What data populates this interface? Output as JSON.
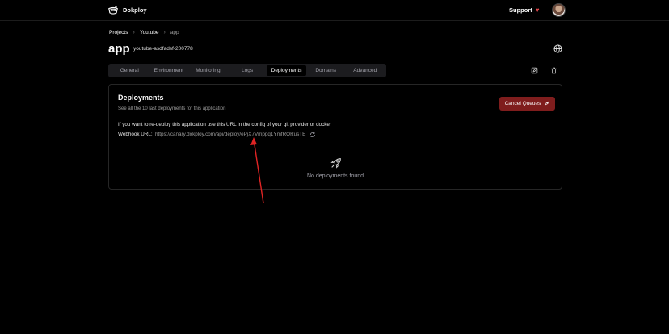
{
  "header": {
    "brand": "Dokploy",
    "support_label": "Support",
    "heart_icon": "♥"
  },
  "breadcrumb": {
    "items": [
      "Projects",
      "Youtube"
    ],
    "current": "app",
    "separator": "›"
  },
  "app": {
    "title": "app",
    "id": "youtube-asdfadsf-200778"
  },
  "tabs": [
    {
      "label": "General"
    },
    {
      "label": "Environment"
    },
    {
      "label": "Monitoring"
    },
    {
      "label": "Logs"
    },
    {
      "label": "Deployments"
    },
    {
      "label": "Domains"
    },
    {
      "label": "Advanced"
    }
  ],
  "active_tab": "Deployments",
  "deployments": {
    "title": "Deployments",
    "subtitle": "See all the 10 last deployments for this application",
    "cancel_label": "Cancel Queues",
    "info": "If you want to re-deploy this application use this URL in the config of your git provider or docker",
    "webhook_label": "Webhook URL:",
    "webhook_url": "https://canary.dokploy.com/api/deploy/ePjX7Vmppq1YmfRORusTE",
    "empty": "No deployments found"
  },
  "colors": {
    "accent_red": "#7f1d1d",
    "heart": "#e5484d",
    "arrow": "#e02424"
  },
  "icons": [
    "logo-icon",
    "heart-icon",
    "globe-icon",
    "edit-icon",
    "trash-icon",
    "rocket-icon",
    "refresh-icon"
  ]
}
